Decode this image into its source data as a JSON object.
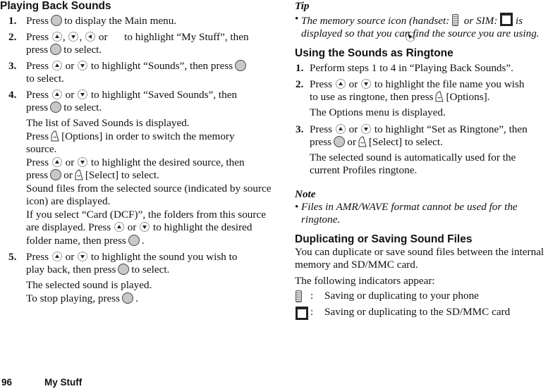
{
  "left": {
    "heading": "Playing Back Sounds",
    "steps": [
      {
        "num": "1.",
        "t": [
          "Press",
          "to display the Main menu."
        ]
      },
      {
        "num": "2.",
        "t": [
          "Press",
          ",",
          ",",
          "or",
          "to highlight “My Stuff”, then",
          "press",
          "to select."
        ]
      },
      {
        "num": "3.",
        "t": [
          "Press",
          "or",
          "to highlight “Sounds”, then press",
          "to select."
        ]
      },
      {
        "num": "4.",
        "t": [
          "Press",
          "or",
          "to highlight “Saved Sounds”, then",
          "press",
          "to select."
        ],
        "sub": [
          "The list of Saved Sounds is displayed.",
          "Press",
          "[Options] in order to switch the memory",
          "source.",
          "Press",
          "or",
          "to highlight the desired source, then",
          "press",
          "or",
          "[Select] to select.",
          "Sound files from the selected source (indicated by source icon) are displayed.",
          "If you select “Card (DCF)”, the folders from this source are displayed. Press",
          "or",
          "to highlight the desired folder name, then press",
          "."
        ]
      },
      {
        "num": "5.",
        "t": [
          "Press",
          "or",
          "to highlight the sound you wish to",
          "play back, then press",
          "to select."
        ],
        "sub": [
          "The selected sound is played.",
          "To stop playing, press",
          "."
        ]
      }
    ]
  },
  "right": {
    "tip": {
      "heading": "Tip",
      "text": [
        "The memory source icon (handset:",
        "or SIM:",
        "is displayed so that you can find the source you are using."
      ]
    },
    "heading1": "Using the Sounds as Ringtone",
    "steps": [
      {
        "num": "1.",
        "t": [
          "Perform steps 1 to 4 in “Playing Back Sounds”."
        ]
      },
      {
        "num": "2.",
        "t": [
          "Press",
          "or",
          "to highlight the file name you wish",
          "to use as ringtone, then press",
          "[Options]."
        ],
        "sub": [
          "The Options menu is displayed."
        ]
      },
      {
        "num": "3.",
        "t": [
          "Press",
          "or",
          "to highlight “Set as Ringtone”, then",
          "press",
          "or",
          "[Select] to select."
        ],
        "sub": [
          "The selected sound is automatically used for the current Profiles ringtone."
        ]
      }
    ],
    "note": {
      "heading": "Note",
      "text": "Files in AMR/WAVE format cannot be used for the ringtone."
    },
    "heading2": "Duplicating or Saving Sound Files",
    "intro": "You can duplicate or save sound files between the internal memory and SD/MMC card.",
    "indicators_intro": "The following indicators appear:",
    "indicators": [
      {
        "icon": "handset-icon",
        "text": "Saving or duplicating to your phone"
      },
      {
        "icon": "sd-card-icon",
        "text": "Saving or duplicating to the SD/MMC card"
      }
    ]
  },
  "footer": {
    "page": "96",
    "section": "My Stuff"
  }
}
